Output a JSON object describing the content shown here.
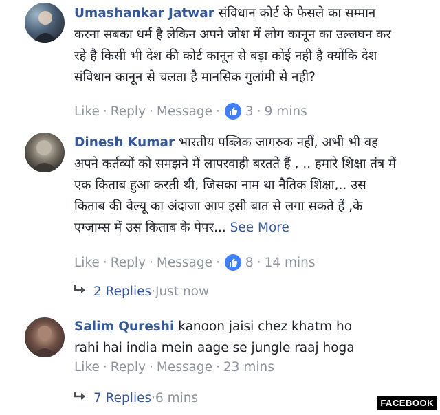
{
  "comments": [
    {
      "author": "Umashankar Jatwar",
      "text": "संविधान कोर्ट के फैसले का सम्मान करना सबका धर्म है लेकिन अपने जोश में लोग कानून का उल्लघन कर रहे है किसी भी देश की कोर्ट कानून से बड़ा कोई नही है क्योंकि देश संविधान कानून से चलता है मानसिक गुलांमी से नही?",
      "actions": {
        "like": "Like",
        "reply": "Reply",
        "message": "Message",
        "likes": "3",
        "time": "9 mins"
      }
    },
    {
      "author": "Dinesh Kumar",
      "text": "भारतीय पब्लिक जागरुक नहीं, अभी भी वह अपने कर्तव्यों को समझने में लापरवाही बरतते हैं , .. हमारे शिक्षा तंत्र में एक किताब हुआ करती थी, जिसका नाम था नैतिक शिक्षा,.. उस किताब की वैल्यू का अंदाजा आप इसी बात से लगा सकते हैं ,के एग्जाम्स में उस किताब के पेपर...",
      "see_more": "See More",
      "actions": {
        "like": "Like",
        "reply": "Reply",
        "message": "Message",
        "likes": "8",
        "time": "14 mins"
      },
      "replies": {
        "label": "2 Replies",
        "time": "Just now"
      }
    },
    {
      "author": "Salim Qureshi",
      "text": "kanoon jaisi chez khatm ho rahi hai india mein aage se jungle raaj hoga",
      "actions": {
        "like": "Like",
        "reply": "Reply",
        "message": "Message",
        "time": "23 mins"
      },
      "replies": {
        "label": "7 Replies",
        "time": "6 mins"
      }
    }
  ],
  "watermark": "FACEBOOK",
  "colors": {
    "link": "#365899",
    "meta": "#8d949e",
    "like_badge": "#4080ff"
  }
}
